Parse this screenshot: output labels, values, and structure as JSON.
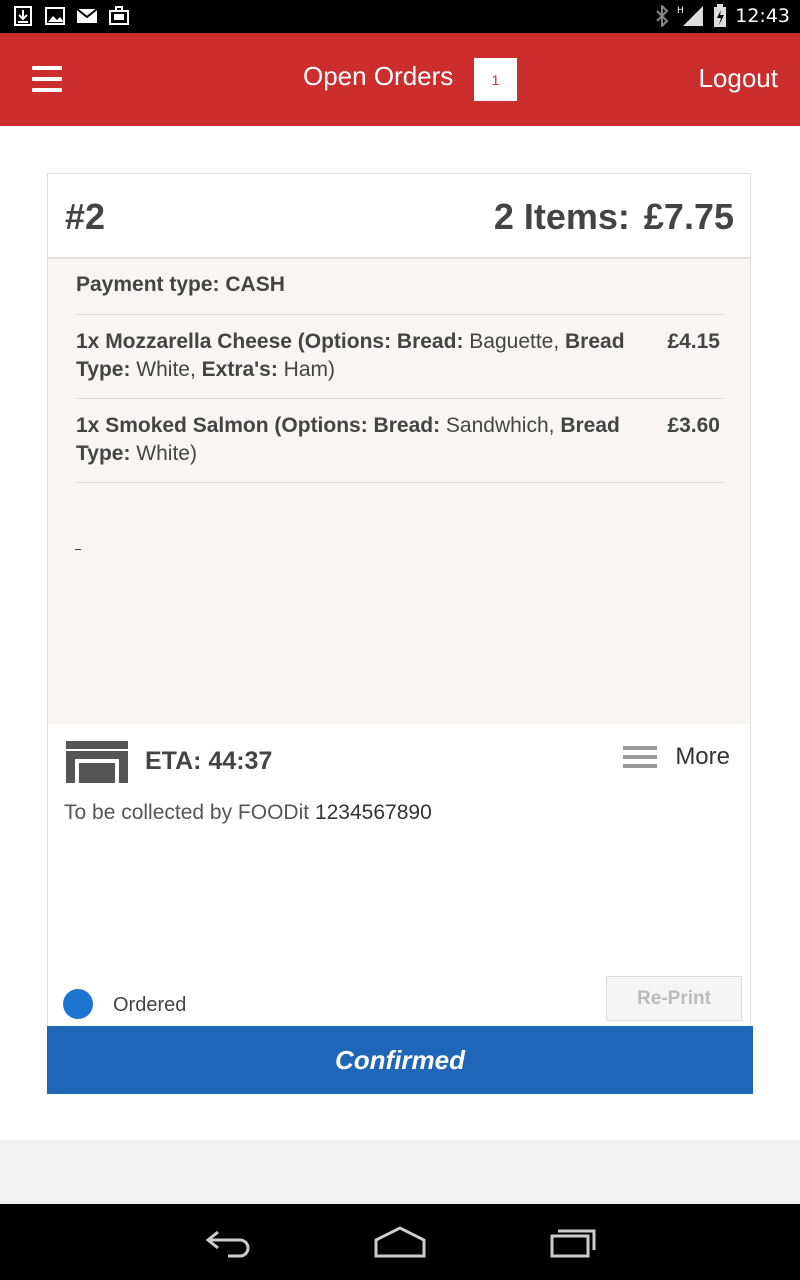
{
  "status_bar": {
    "time": "12:43",
    "icons": [
      "download-icon",
      "image-icon",
      "mail-icon",
      "briefcase-icon",
      "bluetooth-icon",
      "signal-icon",
      "battery-icon"
    ]
  },
  "app_bar": {
    "title": "Open Orders",
    "badge_count": "1",
    "logout_label": "Logout",
    "color": "#cc2e2e"
  },
  "order": {
    "number": "#2",
    "summary": "2 Items:",
    "total": "£7.75",
    "payment_type": "Payment type: CASH",
    "items": [
      {
        "qty_name": "1x Mozzarella Cheese",
        "options_prefix": " (Options: Bread:",
        "bread": " Baguette, ",
        "bread_type_label": "Bread Type:",
        "bread_type": " White, ",
        "extras_label": "Extra's:",
        "extras": " Ham)",
        "price": "£4.15"
      },
      {
        "qty_name": "1x Smoked Salmon",
        "options_prefix": " (Options: Bread:",
        "bread": " Sandwhich, ",
        "bread_type_label": "Bread Type:",
        "bread_type": " White)",
        "price": "£3.60"
      }
    ],
    "eta": "ETA: 44:37",
    "more_label": "More",
    "collect_text": "To be collected by FOODit",
    "phone": "1234567890",
    "status": "Ordered",
    "status_color": "#1e74d1",
    "reprint_label": "Re-Print",
    "confirm_label": "Confirmed",
    "confirm_color": "#2066b8"
  },
  "nav": {
    "icons": [
      "back-icon",
      "home-icon",
      "recents-icon"
    ]
  }
}
